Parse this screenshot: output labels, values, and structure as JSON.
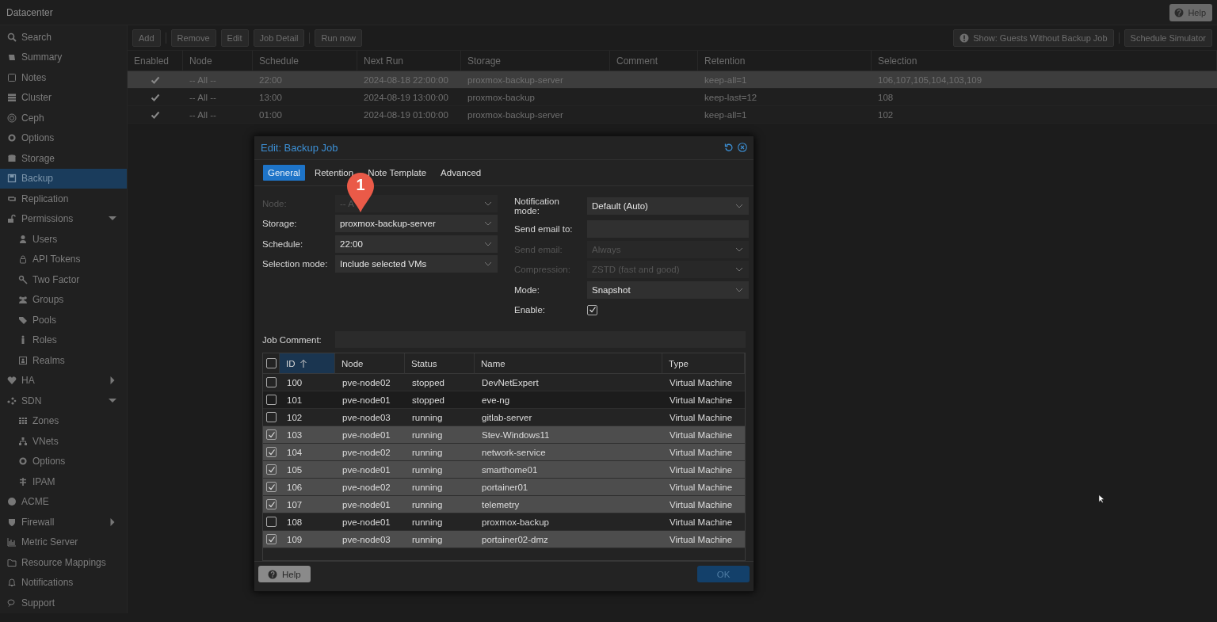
{
  "header": {
    "title": "Datacenter",
    "help_button": "Help"
  },
  "sidebar": {
    "items": [
      {
        "label": "Search",
        "selected": false
      },
      {
        "label": "Summary",
        "selected": false
      },
      {
        "label": "Notes",
        "selected": false
      },
      {
        "label": "Cluster",
        "selected": false
      },
      {
        "label": "Ceph",
        "selected": false
      },
      {
        "label": "Options",
        "selected": false
      },
      {
        "label": "Storage",
        "selected": false
      },
      {
        "label": "Backup",
        "selected": true
      },
      {
        "label": "Replication",
        "selected": false
      },
      {
        "label": "Permissions",
        "selected": false,
        "expanded": true,
        "children": [
          {
            "label": "Users",
            "selected": false
          },
          {
            "label": "API Tokens",
            "selected": false
          },
          {
            "label": "Two Factor",
            "selected": false
          },
          {
            "label": "Groups",
            "selected": false
          },
          {
            "label": "Pools",
            "selected": false
          },
          {
            "label": "Roles",
            "selected": false
          },
          {
            "label": "Realms",
            "selected": false
          }
        ]
      },
      {
        "label": "HA",
        "selected": false,
        "expanded": false
      },
      {
        "label": "SDN",
        "selected": false,
        "expanded": true,
        "children": [
          {
            "label": "Zones",
            "selected": false
          },
          {
            "label": "VNets",
            "selected": false
          },
          {
            "label": "Options",
            "selected": false
          },
          {
            "label": "IPAM",
            "selected": false
          }
        ]
      },
      {
        "label": "ACME",
        "selected": false
      },
      {
        "label": "Firewall",
        "selected": false,
        "expanded": false
      },
      {
        "label": "Metric Server",
        "selected": false
      },
      {
        "label": "Resource Mappings",
        "selected": false
      },
      {
        "label": "Notifications",
        "selected": false
      },
      {
        "label": "Support",
        "selected": false
      }
    ]
  },
  "toolbar": {
    "left": [
      "Add",
      "Remove",
      "Edit",
      "Job Detail",
      "Run now"
    ],
    "show_guests_button": "Show: Guests Without Backup Job",
    "schedule_simulator_button": "Schedule Simulator"
  },
  "jobs_table": {
    "columns": [
      "Enabled",
      "Node",
      "Schedule",
      "Next Run",
      "Storage",
      "Comment",
      "Retention",
      "Selection"
    ],
    "rows": [
      {
        "enabled": true,
        "selected": true,
        "node": "-- All --",
        "schedule": "22:00",
        "next_run": "2024-08-18 22:00:00",
        "storage": "proxmox-backup-server",
        "retention": "keep-all=1",
        "selection": "106,107,105,104,103,109"
      },
      {
        "enabled": true,
        "selected": false,
        "node": "-- All --",
        "schedule": "13:00",
        "next_run": "2024-08-19 13:00:00",
        "storage": "proxmox-backup",
        "retention": "keep-last=12",
        "selection": "108"
      },
      {
        "enabled": true,
        "selected": false,
        "node": "-- All --",
        "schedule": "01:00",
        "next_run": "2024-08-19 01:00:00",
        "storage": "proxmox-backup-server",
        "retention": "keep-all=1",
        "selection": "102"
      }
    ]
  },
  "dialog": {
    "title": "Edit: Backup Job",
    "tabs": [
      {
        "label": "General",
        "selected": true
      },
      {
        "label": "Retention",
        "selected": false
      },
      {
        "label": "Note Template",
        "selected": false
      },
      {
        "label": "Advanced",
        "selected": false
      }
    ],
    "left_fields": [
      {
        "label": "Node:",
        "kind": "combo",
        "value": "-- A",
        "disabled": true
      },
      {
        "label": "Storage:",
        "kind": "combo",
        "value": "proxmox-backup-server",
        "disabled": false
      },
      {
        "label": "Schedule:",
        "kind": "combo",
        "value": "22:00",
        "disabled": false
      },
      {
        "label": "Selection mode:",
        "kind": "combo",
        "value": "Include selected VMs",
        "disabled": false
      }
    ],
    "right_fields": [
      {
        "label": "Notification mode:",
        "kind": "combo",
        "value": "Default (Auto)",
        "disabled": false
      },
      {
        "label": "Send email to:",
        "kind": "text"
      },
      {
        "label": "Send email:",
        "kind": "combo",
        "value": "Always",
        "disabled": true
      },
      {
        "label": "Compression:",
        "kind": "combo",
        "value": "ZSTD (fast and good)",
        "disabled": true
      },
      {
        "label": "Mode:",
        "kind": "combo",
        "value": "Snapshot",
        "disabled": false
      },
      {
        "label": "Enable:",
        "kind": "checkbox",
        "checked": true,
        "disabled": false
      }
    ],
    "job_comment": {
      "label": "Job Comment:"
    },
    "guests": {
      "all_checked": false,
      "columns": [
        {
          "label": "ID",
          "sorted": true
        },
        {
          "label": "Node",
          "sorted": false
        },
        {
          "label": "Status",
          "sorted": false
        },
        {
          "label": "Name",
          "sorted": false
        },
        {
          "label": "Type",
          "sorted": false
        }
      ],
      "rows": [
        {
          "selected": false,
          "id": "100",
          "node": "pve-node02",
          "status": "stopped",
          "name": "DevNetExpert",
          "type": "Virtual Machine"
        },
        {
          "selected": false,
          "id": "101",
          "node": "pve-node01",
          "status": "stopped",
          "name": "eve-ng",
          "type": "Virtual Machine"
        },
        {
          "selected": false,
          "id": "102",
          "node": "pve-node03",
          "status": "running",
          "name": "gitlab-server",
          "type": "Virtual Machine"
        },
        {
          "selected": true,
          "id": "103",
          "node": "pve-node01",
          "status": "running",
          "name": "Stev-Windows11",
          "type": "Virtual Machine"
        },
        {
          "selected": true,
          "id": "104",
          "node": "pve-node02",
          "status": "running",
          "name": "network-service",
          "type": "Virtual Machine"
        },
        {
          "selected": true,
          "id": "105",
          "node": "pve-node01",
          "status": "running",
          "name": "smarthome01",
          "type": "Virtual Machine"
        },
        {
          "selected": true,
          "id": "106",
          "node": "pve-node02",
          "status": "running",
          "name": "portainer01",
          "type": "Virtual Machine"
        },
        {
          "selected": true,
          "id": "107",
          "node": "pve-node01",
          "status": "running",
          "name": "telemetry",
          "type": "Virtual Machine"
        },
        {
          "selected": false,
          "id": "108",
          "node": "pve-node01",
          "status": "running",
          "name": "proxmox-backup",
          "type": "Virtual Machine"
        },
        {
          "selected": true,
          "id": "109",
          "node": "pve-node03",
          "status": "running",
          "name": "portainer02-dmz",
          "type": "Virtual Machine"
        }
      ]
    },
    "help_button": "Help",
    "ok_button": "OK"
  },
  "callout": {
    "label": "1"
  }
}
